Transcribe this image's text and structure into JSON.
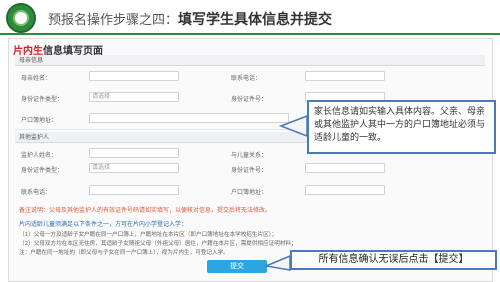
{
  "header": {
    "title_prefix": "预报名操作步骤之四：",
    "title_main": "填写学生具体信息并提交"
  },
  "page": {
    "title_red": "片内生",
    "title_rest": "信息填写页面"
  },
  "section1": {
    "heading": "母亲信息",
    "fields": {
      "name_label": "母亲姓名：",
      "phone_label": "联系电话：",
      "idtype_label": "身份证件类型：",
      "idtype_value": "请选择",
      "idno_label": "身份证件号：",
      "hukou_label": "户口簿地址："
    }
  },
  "section2": {
    "heading": "其他监护人",
    "fields": {
      "name_label": "监护人姓名：",
      "relation_label": "与儿童关系：",
      "idtype_label": "身份证件类型：",
      "idtype_value": "请选择",
      "idno_label": "身份证件号：",
      "phone_label": "联系电话：",
      "hukou_label": "户口簿地址："
    }
  },
  "tip": "备注说明：父母及其他监护人的有效证件号码请如实填写，以便核对信息，提交后将无法修改。",
  "notes": {
    "title": "片内适龄儿童须满足以下条件之一，方可在片内小学登记入学：",
    "line1": "（1）父母一方及适龄子女户籍在同一户口簿上，户籍地址在本片区（即户口簿地址在本学校招生片区）；",
    "line2": "（2）父母双方均在本区无住房，其适龄子女随祖父母（外祖父母）居住，户籍在本片区，需提供相应证明材料；",
    "line3": "注：户籍在同一地址的（即父母与子女在同一户口簿上），视为片内生，可登记入学。"
  },
  "submit_label": "提交",
  "callouts": {
    "parents": "家长信息请如实输入具体内容。父亲、母亲或其他监护人其中一方的户口簿地址必须与适龄儿童的一致。",
    "submit": "所有信息确认无误后点击【提交】"
  },
  "colors": {
    "accent_green": "#2e8b3e",
    "title_red": "#d61f1f",
    "callout_border": "#4a7ab8",
    "button_blue": "#2aa6e0"
  }
}
